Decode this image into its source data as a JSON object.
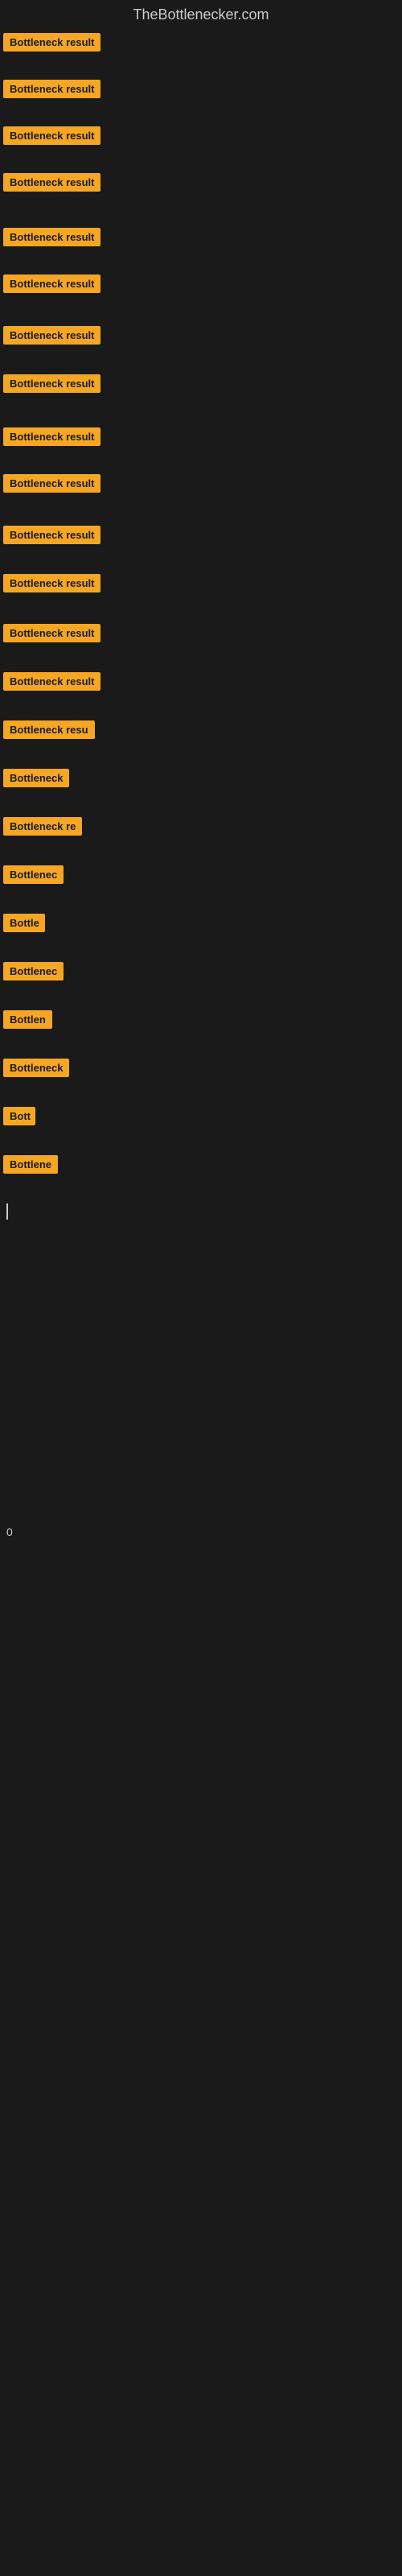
{
  "header": {
    "title": "TheBottlenecker.com"
  },
  "items": [
    {
      "label": "Bottleneck result",
      "width": "full"
    },
    {
      "label": "Bottleneck result",
      "width": "full"
    },
    {
      "label": "Bottleneck result",
      "width": "full"
    },
    {
      "label": "Bottleneck result",
      "width": "full"
    },
    {
      "label": "Bottleneck result",
      "width": "full"
    },
    {
      "label": "Bottleneck result",
      "width": "full"
    },
    {
      "label": "Bottleneck result",
      "width": "full"
    },
    {
      "label": "Bottleneck result",
      "width": "full"
    },
    {
      "label": "Bottleneck result",
      "width": "full"
    },
    {
      "label": "Bottleneck result",
      "width": "full"
    },
    {
      "label": "Bottleneck result",
      "width": "full"
    },
    {
      "label": "Bottleneck result",
      "width": "full"
    },
    {
      "label": "Bottleneck result",
      "width": "full"
    },
    {
      "label": "Bottleneck result",
      "width": "full"
    },
    {
      "label": "Bottleneck resu",
      "width": "partial1"
    },
    {
      "label": "Bottleneck",
      "width": "partial2"
    },
    {
      "label": "Bottleneck re",
      "width": "partial3"
    },
    {
      "label": "Bottlenec",
      "width": "partial4"
    },
    {
      "label": "Bottle",
      "width": "partial5"
    },
    {
      "label": "Bottlenec",
      "width": "partial4"
    },
    {
      "label": "Bottlen",
      "width": "partial6"
    },
    {
      "label": "Bottleneck",
      "width": "partial2"
    },
    {
      "label": "Bott",
      "width": "partial7"
    },
    {
      "label": "Bottlene",
      "width": "partial8"
    }
  ],
  "footer": {
    "cursor": true,
    "single_char": "0"
  },
  "colors": {
    "badge_bg": "#f5a623",
    "badge_text": "#1a1a1a",
    "background": "#1a1a1a",
    "header_text": "#cccccc"
  }
}
